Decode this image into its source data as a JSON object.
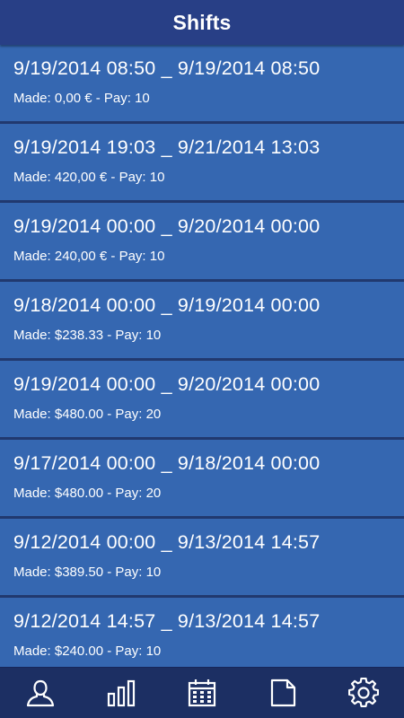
{
  "header": {
    "title": "Shifts"
  },
  "shifts": [
    {
      "range": "9/19/2014 08:50 _ 9/19/2014 08:50",
      "made": "Made: 0,00 € - Pay: 10"
    },
    {
      "range": "9/19/2014 19:03 _ 9/21/2014 13:03",
      "made": "Made: 420,00 € - Pay: 10"
    },
    {
      "range": "9/19/2014 00:00 _ 9/20/2014 00:00",
      "made": "Made: 240,00 € - Pay: 10"
    },
    {
      "range": "9/18/2014 00:00 _ 9/19/2014 00:00",
      "made": "Made: $238.33 - Pay: 10"
    },
    {
      "range": "9/19/2014 00:00 _ 9/20/2014 00:00",
      "made": "Made: $480.00 - Pay: 20"
    },
    {
      "range": "9/17/2014 00:00 _ 9/18/2014 00:00",
      "made": "Made: $480.00 - Pay: 20"
    },
    {
      "range": "9/12/2014 00:00 _ 9/13/2014 14:57",
      "made": "Made: $389.50 - Pay: 10"
    },
    {
      "range": "9/12/2014 14:57 _ 9/13/2014 14:57",
      "made": "Made: $240.00 - Pay: 10"
    }
  ],
  "nav": {
    "items": [
      {
        "icon": "user-icon"
      },
      {
        "icon": "bar-chart-icon"
      },
      {
        "icon": "calendar-icon"
      },
      {
        "icon": "document-icon"
      },
      {
        "icon": "gear-icon"
      }
    ]
  },
  "colors": {
    "header": "#283f86",
    "item": "#3567b1",
    "divider": "#21396f",
    "nav": "#1c2f63"
  }
}
